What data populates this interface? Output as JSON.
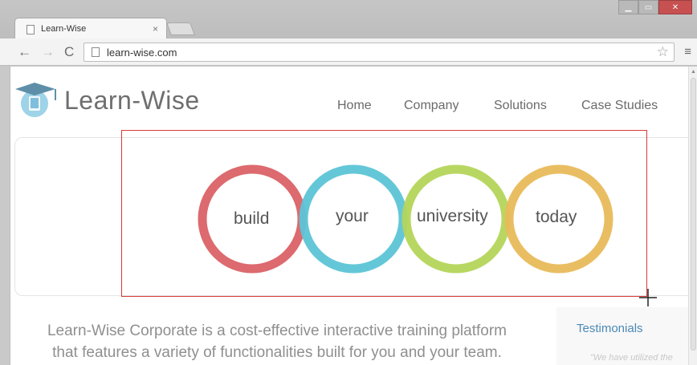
{
  "browser": {
    "tab_title": "Learn-Wise",
    "tab_close": "×",
    "url": "learn-wise.com",
    "back_icon": "←",
    "forward_icon": "→",
    "reload_icon": "C",
    "star_icon": "☆",
    "menu_icon": "≡",
    "minimize": "▁",
    "maximize": "▭",
    "close": "✕"
  },
  "site": {
    "logo_text": "Learn-Wise",
    "nav": [
      "Home",
      "Company",
      "Solutions",
      "Case Studies"
    ],
    "hero_words": [
      "build",
      "your",
      "university",
      "today"
    ],
    "ring_colors": [
      "#dc6a6e",
      "#5cc4d6",
      "#b4d55a",
      "#e8bb5a"
    ],
    "tagline_line1": "Learn-Wise Corporate is a cost-effective interactive training platform",
    "tagline_line2": "that features a variety of functionalities built for you and your team.",
    "testimonials_title": "Testimonials",
    "testimonial_quote": "\"We have utilized the"
  }
}
